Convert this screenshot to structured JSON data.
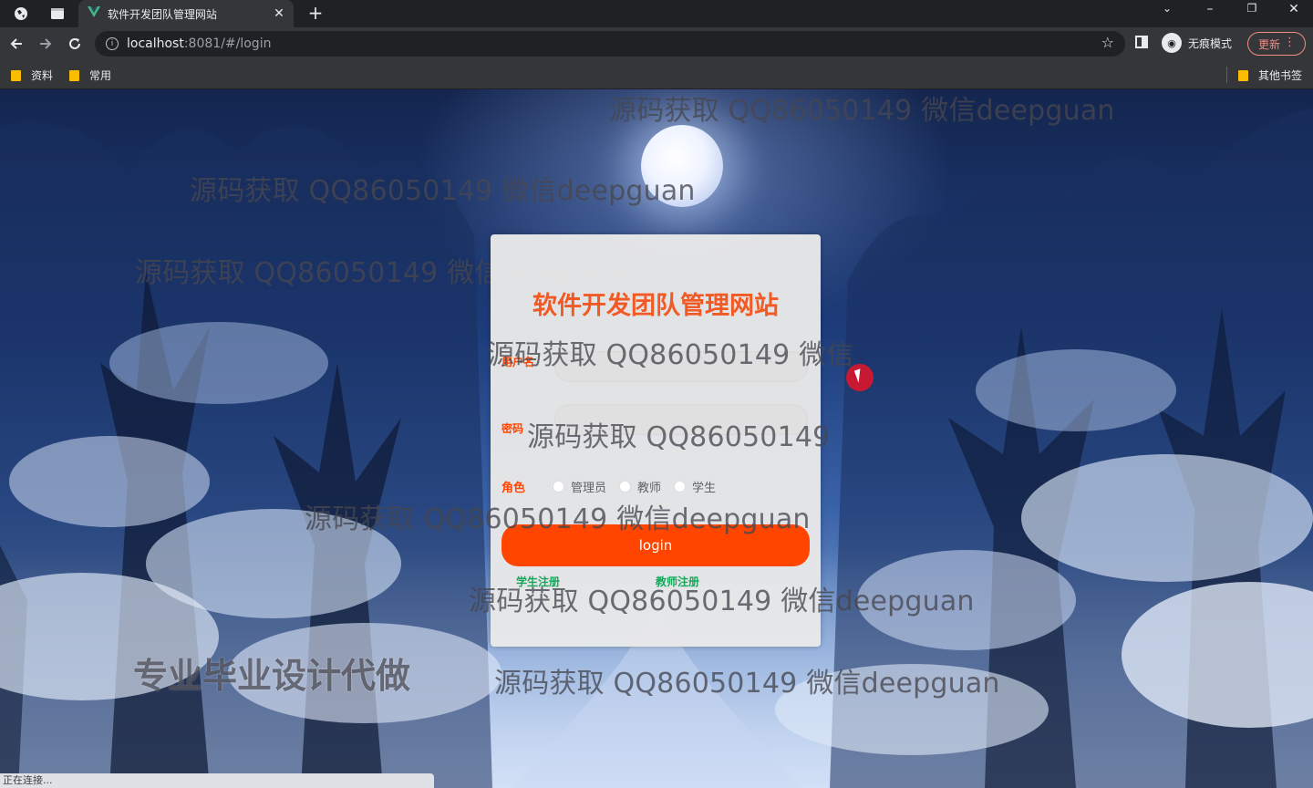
{
  "browser": {
    "tab_title": "软件开发团队管理网站",
    "url_host": "localhost",
    "url_rest": ":8081/#/login",
    "incognito_label": "无痕模式",
    "update_label": "更新",
    "bookmarks": [
      "资料",
      "常用"
    ],
    "other_bookmarks": "其他书签",
    "status_text": "正在连接..."
  },
  "login": {
    "title": "软件开发团队管理网站",
    "username_label": "用户名",
    "password_label": "密码",
    "role_label": "角色",
    "roles": [
      "管理员",
      "教师",
      "学生"
    ],
    "login_button": "login",
    "student_register": "学生注册",
    "teacher_register": "教师注册"
  },
  "watermarks": {
    "text": "源码获取 QQ86050149 微信deepguan",
    "partial_1": "源码获取 QQ86050149 微信",
    "partial_2": "源码获取 QQ86050149",
    "partial_3": "源码获取 QQ86050149 微信deepguan",
    "big": "专业毕业设计代做"
  },
  "colors": {
    "accent": "#ff4500",
    "title": "#f15a24",
    "register_link": "#19a65b"
  }
}
